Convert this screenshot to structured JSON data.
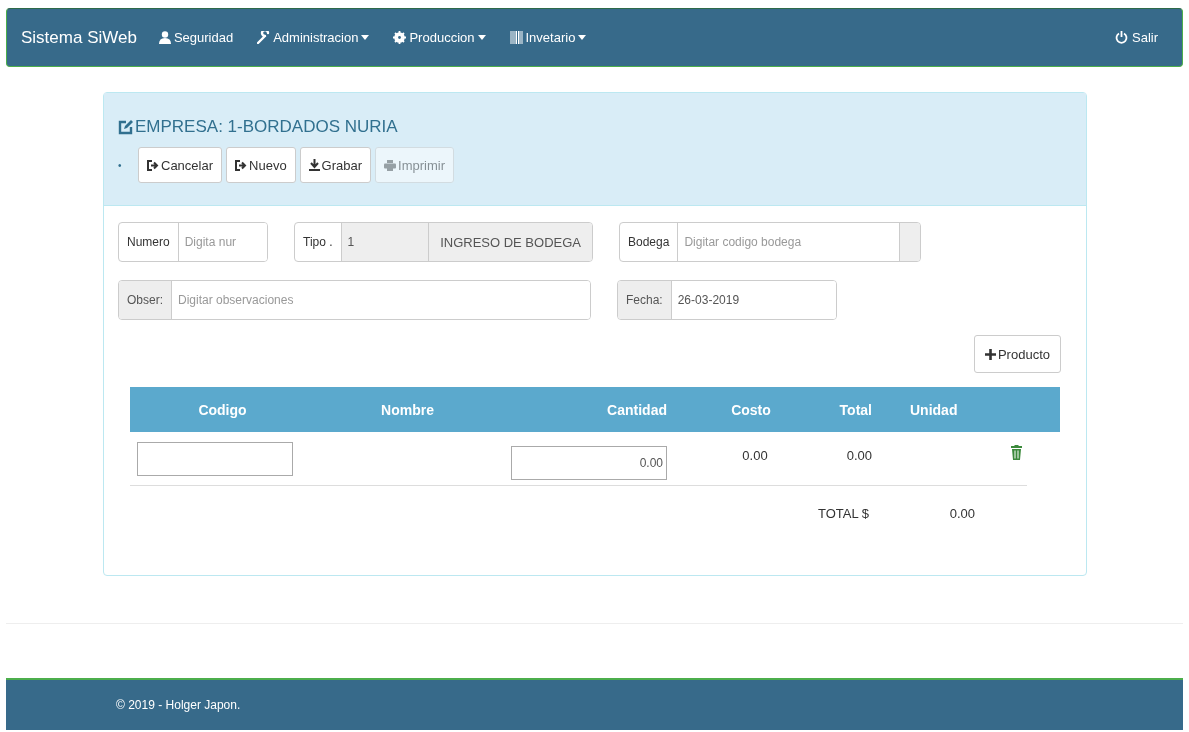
{
  "navbar": {
    "brand": "Sistema SiWeb",
    "menu": [
      {
        "label": "Seguridad",
        "dropdown": false
      },
      {
        "label": "Administracion",
        "dropdown": true
      },
      {
        "label": "Produccion",
        "dropdown": true
      },
      {
        "label": "Invetario",
        "dropdown": true
      }
    ],
    "logout": "Salir"
  },
  "panel": {
    "title": "EMPRESA: 1-BORDADOS NURIA",
    "bullet": "•",
    "buttons": [
      {
        "label": "Cancelar",
        "disabled": false
      },
      {
        "label": "Nuevo",
        "disabled": false
      },
      {
        "label": "Grabar",
        "disabled": false
      },
      {
        "label": "Imprimir",
        "disabled": true
      }
    ],
    "fields": [
      {
        "kind": "text",
        "label": "Numero",
        "label_shaded": false,
        "placeholder": "Digita nur"
      },
      {
        "kind": "readonly",
        "label": "Tipo .",
        "label_shaded": false,
        "value": "1",
        "suffix": "INGRESO DE BODEGA"
      },
      {
        "kind": "lookup",
        "label": "Bodega",
        "label_shaded": false,
        "placeholder": "Digitar codigo bodega"
      },
      {
        "kind": "text",
        "label": "Obser:",
        "label_shaded": true,
        "placeholder": "Digitar observaciones"
      },
      {
        "kind": "text",
        "label": "Fecha:",
        "label_shaded": true,
        "value": "26-03-2019"
      }
    ],
    "add_button": "Producto",
    "table": {
      "columns": [
        "Codigo",
        "Nombre",
        "Cantidad",
        "Costo",
        "Total",
        "Unidad"
      ],
      "rows": [
        {
          "codigo": "",
          "cantidad": "0.00",
          "costo": "0.00",
          "total": "0.00"
        }
      ],
      "total_label": "TOTAL $",
      "total_value": "0.00"
    }
  },
  "footer": {
    "text": "© 2019 - Holger Japon."
  }
}
